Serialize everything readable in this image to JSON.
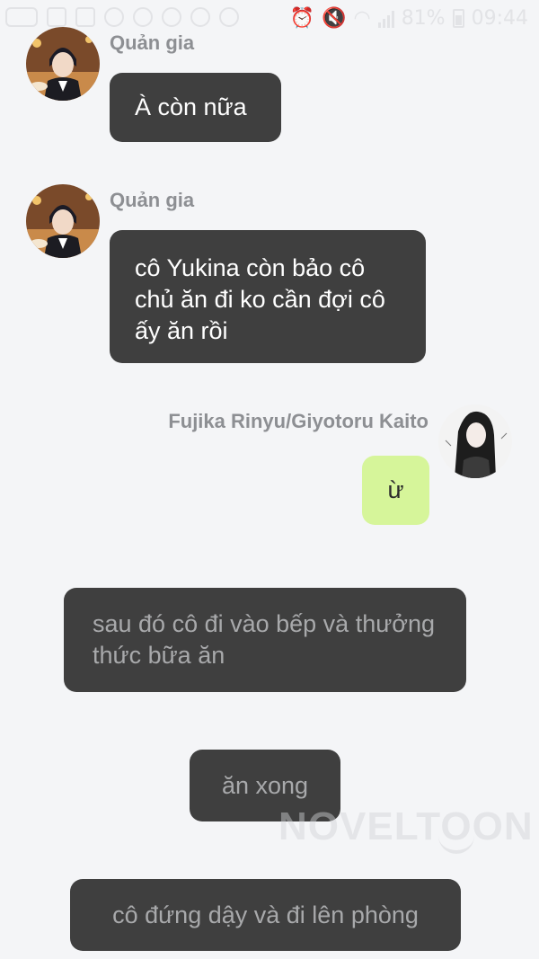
{
  "status_bar": {
    "battery": "81%",
    "time": "09:44"
  },
  "messages": [
    {
      "sender": "Quản gia",
      "text": "À còn nữa"
    },
    {
      "sender": "Quản gia",
      "text": "cô Yukina còn bảo cô chủ ăn đi ko cần đợi cô ấy ăn rồi"
    },
    {
      "sender": "Fujika Rinyu/Giyotoru Kaito",
      "text": "ừ"
    }
  ],
  "narrations": [
    "sau đó cô đi vào bếp và thưởng thức bữa ăn",
    "ăn xong",
    "cô đứng dậy và đi lên phòng"
  ],
  "watermark": "NOVELTOON",
  "colors": {
    "background": "#f4f5f7",
    "bubble_dark": "#3f3f3f",
    "bubble_mine": "#d6f59a",
    "sender_name": "#8d8f93"
  }
}
